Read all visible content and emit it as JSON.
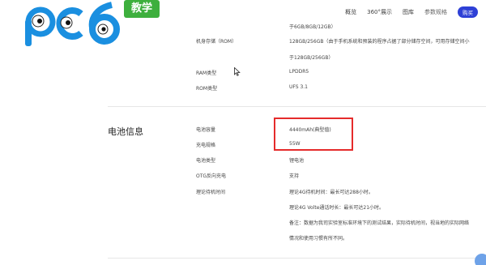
{
  "nav": {
    "links": [
      "概览",
      "360°展示",
      "图库",
      "参数规格"
    ],
    "buy_label": "购买"
  },
  "watermark": {
    "logo_text": "pc6",
    "badge_text": "教学"
  },
  "storage": {
    "partial_value": "于6GB/8GB/12GB）",
    "rom_label": "机身存储（ROM）",
    "rom_value_line1": "128GB/256GB（由于手机系统和预装的程序占据了部分储存空间，可用存储空间小",
    "rom_value_line2": "于128GB/256GB）",
    "ram_type_label": "RAM类型",
    "ram_type_value": "LPDDR5",
    "rom_type_label": "ROM类型",
    "rom_type_value": "UFS 3.1"
  },
  "battery": {
    "section_title": "电池信息",
    "capacity_label": "电池容量",
    "capacity_value": "4440mAh(典型值)",
    "charging_label": "充电规格",
    "charging_value": "55W",
    "type_label": "电池类型",
    "type_value": "锂电池",
    "otg_label": "OTG反向充电",
    "otg_value": "支持",
    "standby_label": "理论待机时间",
    "standby_value_1": "理论4G待机时间：最长可达288小时。",
    "standby_value_2": "理论4G Volte通话时长：最长可达21小时。",
    "note_line1": "备注：数据为我司实验室标准环境下的测试结果，实际待机时间，视当地的实际网络",
    "note_line2": "情况和使用习惯有所不同。"
  },
  "colors": {
    "accent": "#2e40d6",
    "highlight": "#e52b2b",
    "logo_blue": "#1a8fe0",
    "badge_green": "#3daf3d"
  }
}
